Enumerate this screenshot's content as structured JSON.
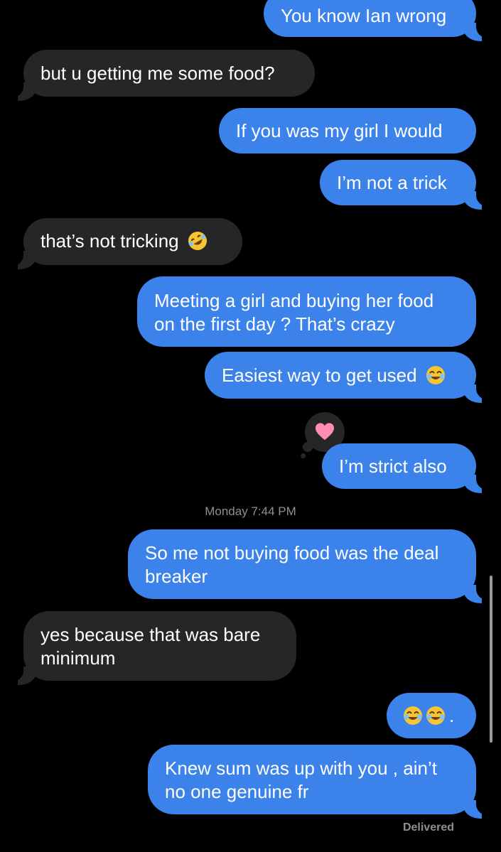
{
  "messages": [
    {
      "text": "You know Ian wrong",
      "direction": "out"
    },
    {
      "text": "but u getting me some food?",
      "direction": "in"
    },
    {
      "text": "If you was my girl I would",
      "direction": "out"
    },
    {
      "text": "I’m not a trick",
      "direction": "out"
    },
    {
      "text": "that’s not tricking",
      "direction": "in",
      "emoji": "rolling-on-floor-laughing-icon"
    },
    {
      "text": "Meeting a girl and buying her food\non the first day ? That’s crazy",
      "direction": "out"
    },
    {
      "text": "Easiest way to get used",
      "direction": "out",
      "emoji": "tears-of-joy-icon"
    },
    {
      "text": "I’m strict also",
      "direction": "out",
      "tapback": "heart-icon"
    },
    {
      "text": "So me not buying food was the deal\nbreaker",
      "direction": "out"
    },
    {
      "text": "yes because that was bare\nminimum",
      "direction": "in"
    },
    {
      "text": ".",
      "direction": "out",
      "emoji": "tears-of-joy-icon x2"
    },
    {
      "text": "Knew sum was up with you , ain’t\nno one genuine fr",
      "direction": "out"
    }
  ],
  "timestamp": {
    "day": "Monday",
    "time": "7:44 PM"
  },
  "status": "Delivered",
  "colors": {
    "outgoing_bubble": "#3b82ea",
    "incoming_bubble": "#262629",
    "background": "#000000",
    "meta_text": "#8e8e93",
    "heart": "#ff7fa8"
  }
}
